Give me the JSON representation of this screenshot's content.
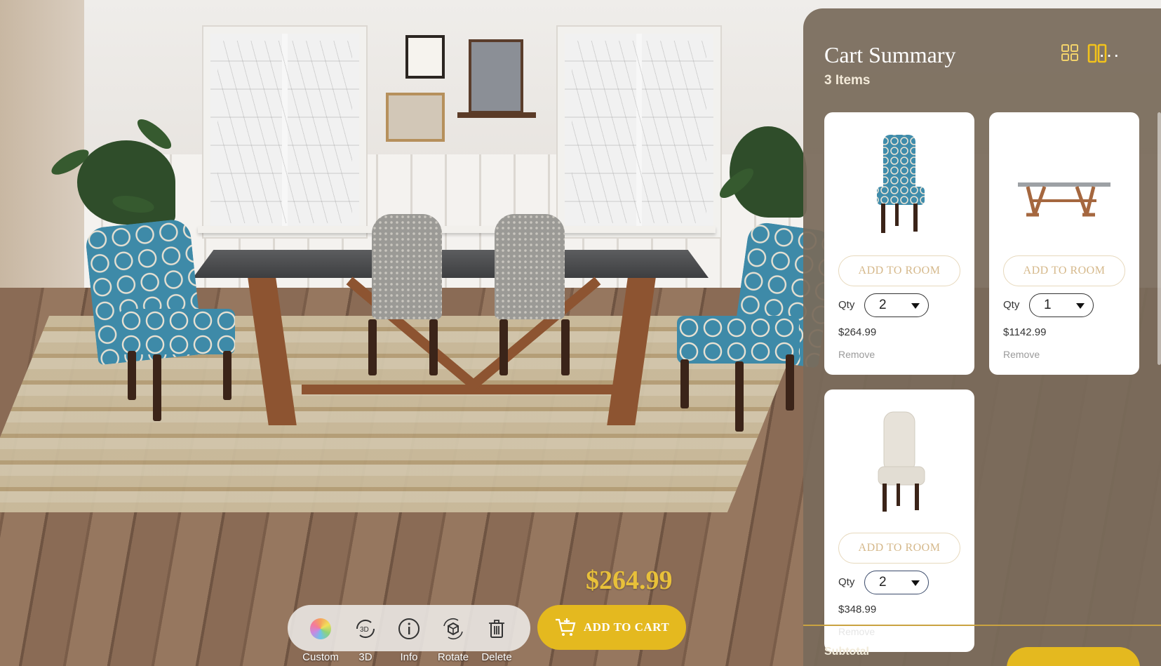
{
  "toolbar": {
    "price": "$264.99",
    "tools": [
      {
        "icon": "color-wheel-icon",
        "label": "Custom"
      },
      {
        "icon": "3d-rotate-icon",
        "label": "3D"
      },
      {
        "icon": "info-icon",
        "label": "Info"
      },
      {
        "icon": "rotate-cube-icon",
        "label": "Rotate"
      },
      {
        "icon": "trash-icon",
        "label": "Delete"
      }
    ],
    "add_to_cart_label": "ADD TO CART"
  },
  "cart": {
    "title": "Cart Summary",
    "count": "3 Items",
    "view_icons": [
      "grid-view-icon",
      "column-view-icon",
      "more-options-icon"
    ],
    "more_label": "···",
    "items": [
      {
        "name": "Blue trellis dining chair",
        "add_label": "ADD TO ROOM",
        "qty_label": "Qty",
        "qty": "2",
        "price": "$264.99",
        "remove_label": "Remove"
      },
      {
        "name": "Trestle dining table",
        "add_label": "ADD TO ROOM",
        "qty_label": "Qty",
        "qty": "1",
        "price": "$1142.99",
        "remove_label": "Remove"
      },
      {
        "name": "Cream upholstered chair",
        "add_label": "ADD TO ROOM",
        "qty_label": "Qty",
        "qty": "2",
        "price": "$348.99",
        "remove_label": "Remove"
      }
    ],
    "subtotal_label": "Subtotal"
  },
  "colors": {
    "accent": "#e4b91f",
    "panel": "#786a5a",
    "price": "#e8c03a"
  }
}
